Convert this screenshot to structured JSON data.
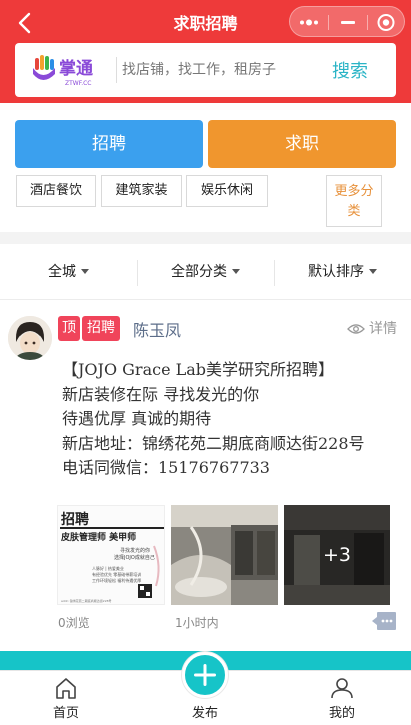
{
  "nav": {
    "title": "求职招聘"
  },
  "search": {
    "logo_text": "掌通",
    "logo_sub": "ZTWF.CC",
    "placeholder": "找店铺，找工作，租房子",
    "button": "搜索"
  },
  "actions": {
    "hire": "招聘",
    "job": "求职"
  },
  "categories": [
    "酒店餐饮",
    "建筑家装",
    "娱乐休闲"
  ],
  "more_categories": [
    "更多分",
    "类"
  ],
  "filters": [
    "全城",
    "全部分类",
    "默认排序"
  ],
  "post": {
    "badge_top": "顶",
    "badge_hire": "招聘",
    "author": "陈玉凤",
    "detail": "详情",
    "lines": [
      "【JOJO Grace Lab美学研究所招聘】",
      "新店装修在际 寻找发光的你",
      "待遇优厚 真诚的期待",
      "新店地址：锦绣花苑二期底商顺达街228号",
      "电话同微信：15176767733"
    ],
    "poster": {
      "line1": "招聘",
      "line2": "皮肤管理师  美甲师",
      "line3": "寻找发光的你",
      "line4": "选择JOJO成就自己",
      "line5": "人脉好 | 热爱美业",
      "line6": "有经验优先 零基础带薪培训",
      "line7": "工作环境轻松 福利待遇优厚",
      "line8": "addr: 锦绣花苑二期底商顺达街228号"
    },
    "more_photos": "+3",
    "views": "0浏览",
    "time": "1小时内"
  },
  "tabs": {
    "home": "首页",
    "publish": "发布",
    "mine": "我的"
  },
  "colors": {
    "header": "#ee3a3a",
    "teal": "#16c4c8",
    "blue": "#3ba0ee",
    "orange": "#f0962e",
    "badge": "#f0445a"
  }
}
